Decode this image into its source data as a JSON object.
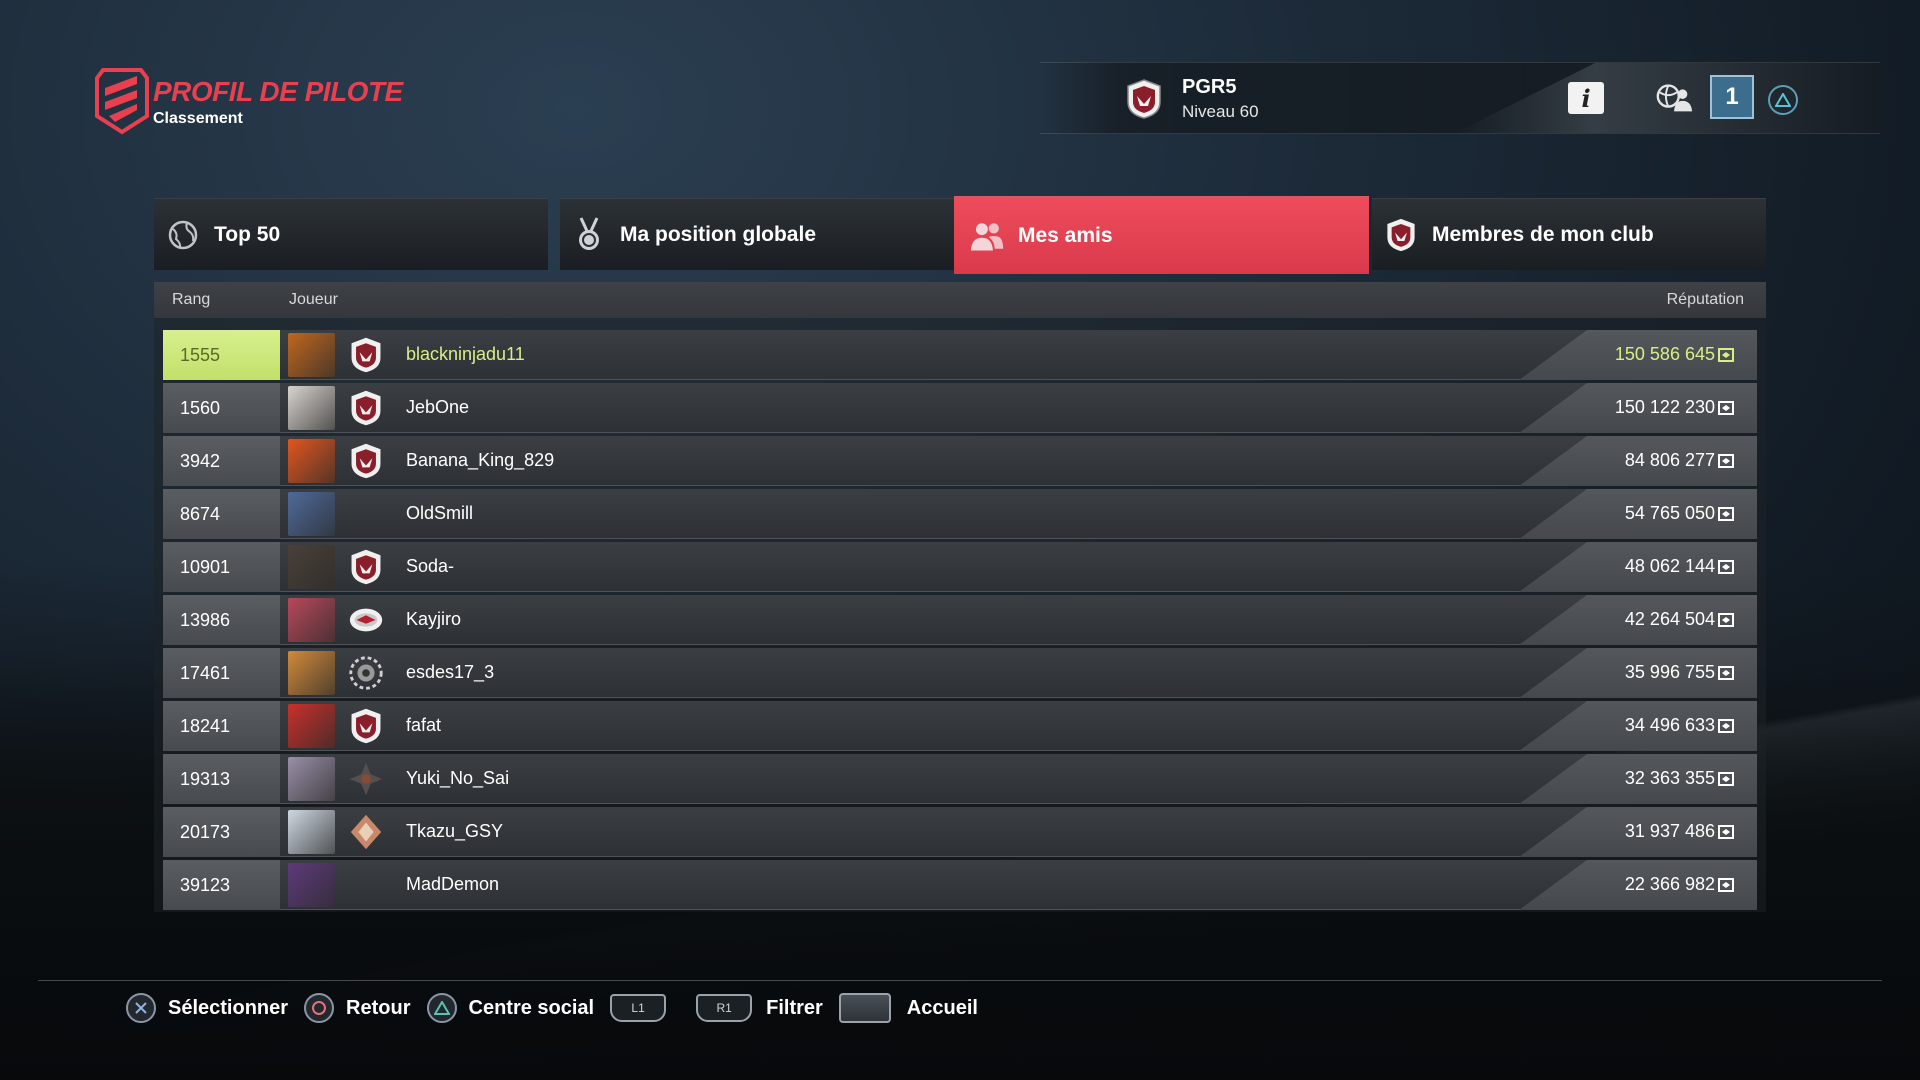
{
  "brand": {
    "title": "PROFIL DE PILOTE",
    "subtitle": "Classement"
  },
  "player": {
    "name": "PGR5",
    "level": "Niveau 60",
    "friends_online": "1"
  },
  "tabs": [
    {
      "label": "Top 50",
      "icon": "globe-icon",
      "active": false
    },
    {
      "label": "Ma position globale",
      "icon": "medal-icon",
      "active": false
    },
    {
      "label": "Mes amis",
      "icon": "friends-icon",
      "active": true
    },
    {
      "label": "Membres de mon club",
      "icon": "club-emblem-icon",
      "active": false
    }
  ],
  "columns": {
    "rank": "Rang",
    "player": "Joueur",
    "reputation": "Réputation"
  },
  "rows": [
    {
      "rank": "1555",
      "name": "blackninjadu11",
      "reputation": "150 586 645",
      "avatar": "#c0671f",
      "club": "shield",
      "me": true
    },
    {
      "rank": "1560",
      "name": "JebOne",
      "reputation": "150 122 230",
      "avatar": "#d9d4cf",
      "club": "shield",
      "me": false
    },
    {
      "rank": "3942",
      "name": "Banana_King_829",
      "reputation": "84 806 277",
      "avatar": "#e2561f",
      "club": "shield",
      "me": false
    },
    {
      "rank": "8674",
      "name": "OldSmill",
      "reputation": "54 765 050",
      "avatar": "#4e6a9a",
      "club": "",
      "me": false
    },
    {
      "rank": "10901",
      "name": "Soda-",
      "reputation": "48 062 144",
      "avatar": "#4a4038",
      "club": "shield",
      "me": false
    },
    {
      "rank": "13986",
      "name": "Kayjiro",
      "reputation": "42 264 504",
      "avatar": "#b8485a",
      "club": "oval",
      "me": false
    },
    {
      "rank": "17461",
      "name": "esdes17_3",
      "reputation": "35 996 755",
      "avatar": "#d28a3a",
      "club": "gear",
      "me": false
    },
    {
      "rank": "18241",
      "name": "fafat",
      "reputation": "34 496 633",
      "avatar": "#c9302a",
      "club": "shield",
      "me": false
    },
    {
      "rank": "19313",
      "name": "Yuki_No_Sai",
      "reputation": "32 363 355",
      "avatar": "#9a8fa8",
      "club": "star",
      "me": false
    },
    {
      "rank": "20173",
      "name": "Tkazu_GSY",
      "reputation": "31 937 486",
      "avatar": "#cfd8e2",
      "club": "diamond",
      "me": false
    },
    {
      "rank": "39123",
      "name": "MadDemon",
      "reputation": "22 366 982",
      "avatar": "#5d3a7a",
      "club": "",
      "me": false
    }
  ],
  "footer": {
    "select": "Sélectionner",
    "back": "Retour",
    "social": "Centre social",
    "l1": "L1",
    "r1": "R1",
    "filter": "Filtrer",
    "home": "Accueil"
  },
  "colors": {
    "accent": "#e8404f",
    "highlight": "#d7ef87",
    "badge": "#3d6d8c"
  }
}
